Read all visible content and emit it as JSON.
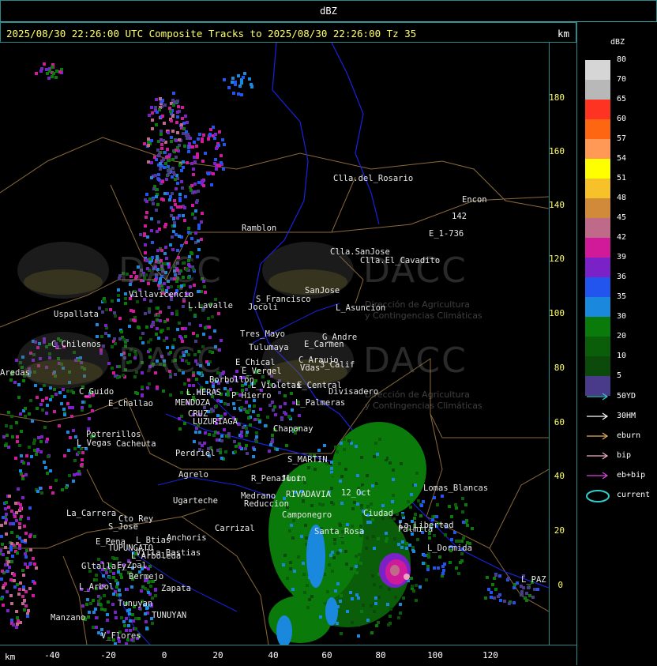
{
  "window": {
    "title": "dBZ"
  },
  "header": {
    "title": "2025/08/30 22:26:00 UTC Composite Tracks to 2025/08/30 22:26:00 Tz 35",
    "unit": "km"
  },
  "yaxis": {
    "ticks": [
      "180",
      "160",
      "140",
      "120",
      "100",
      "80",
      "60",
      "40",
      "20",
      "0"
    ]
  },
  "xaxis": {
    "unit": "km",
    "ticks": [
      "-40",
      "-20",
      "0",
      "20",
      "40",
      "60",
      "80",
      "100",
      "120"
    ]
  },
  "legend": {
    "title": "dBZ",
    "bins": [
      {
        "label": "80",
        "color": "#d6d6d6"
      },
      {
        "label": "70",
        "color": "#b8b8b8"
      },
      {
        "label": "65",
        "color": "#ff3322"
      },
      {
        "label": "60",
        "color": "#ff6611"
      },
      {
        "label": "57",
        "color": "#ff9955"
      },
      {
        "label": "54",
        "color": "#ffff00"
      },
      {
        "label": "51",
        "color": "#f7c229"
      },
      {
        "label": "48",
        "color": "#d18a3a"
      },
      {
        "label": "45",
        "color": "#c06a8a"
      },
      {
        "label": "42",
        "color": "#d01a9a"
      },
      {
        "label": "39",
        "color": "#7a22c8"
      },
      {
        "label": "36",
        "color": "#2255ee"
      },
      {
        "label": "35",
        "color": "#1a88dd"
      },
      {
        "label": "30",
        "color": "#0a7a0a"
      },
      {
        "label": "20",
        "color": "#0a5e0a"
      },
      {
        "label": "10",
        "color": "#0c4a0c"
      },
      {
        "label": "5",
        "color": "#4a3a8a"
      }
    ],
    "tracks": [
      {
        "label": "50YD",
        "color": "#33cccc"
      },
      {
        "label": "30HM",
        "color": "#ffffff"
      },
      {
        "label": "eburn",
        "color": "#e8b060"
      },
      {
        "label": "bip",
        "color": "#f0b0c8"
      },
      {
        "label": "eb+bip",
        "color": "#dd44dd"
      },
      {
        "label": "current",
        "color": "#33cccc"
      }
    ]
  },
  "watermark": {
    "brand": "DACC",
    "subtitle_1": "Dirección de Agricultura",
    "subtitle_2": "y Contingencias Climáticas"
  },
  "places": [
    "Clla.del_Rosario",
    "Encon",
    "142",
    "E_1-736",
    "Ramblon",
    "Clla.SanJose",
    "Clla.El_Cavadito",
    "Villavicencio",
    "Uspallata",
    "L.Lavalle",
    "Jocoli",
    "S_Francisco",
    "SanJose",
    "L_Asuncion",
    "C_Chilenos",
    "Tres_Mayo",
    "Tulumaya",
    "E_Carmen",
    "G_Andre",
    "C_Araujo",
    "Vdas",
    "3_Calif",
    "E_Chical",
    "E_Vergel",
    "Borbollon",
    "L_Violetas",
    "E_Central",
    "Divisadero",
    "C_Guido",
    "L.HERAS",
    "P_Hierro",
    "E_Challao",
    "MENDOZA",
    "L_Palmeras",
    "L_Vegas",
    "Potrerillos",
    "Cacheuta",
    "LUZURIAGA",
    "CRUZ",
    "Perdriel",
    "S_MARTIN",
    "Agrelo",
    "R_Penaflor",
    "Ugarteche",
    "Medrano",
    "Reduccion",
    "RIVADAVIA",
    "12_Oct",
    "Lomas_Blancas",
    "La_Carrera",
    "Cto_Rey",
    "S_Jose",
    "Carrizal",
    "Anchoris",
    "Chapanay",
    "E_Pena",
    "TUPUNGATO",
    "L_Btias",
    "Junin",
    "Gltallary",
    "E_Zpal",
    "L_Arboleda",
    "Palmita",
    "L_Dormida",
    "L_PAZ",
    "L_Arbol",
    "Zapata",
    "Manzano",
    "TUNUYAN",
    "V_Flores",
    "Tunuyan",
    "Bermejo",
    "Aredas",
    "Camponegro",
    "Santa_Rosa",
    "Ciudad",
    "La_Libertad",
    "Villa_Bastias"
  ]
}
